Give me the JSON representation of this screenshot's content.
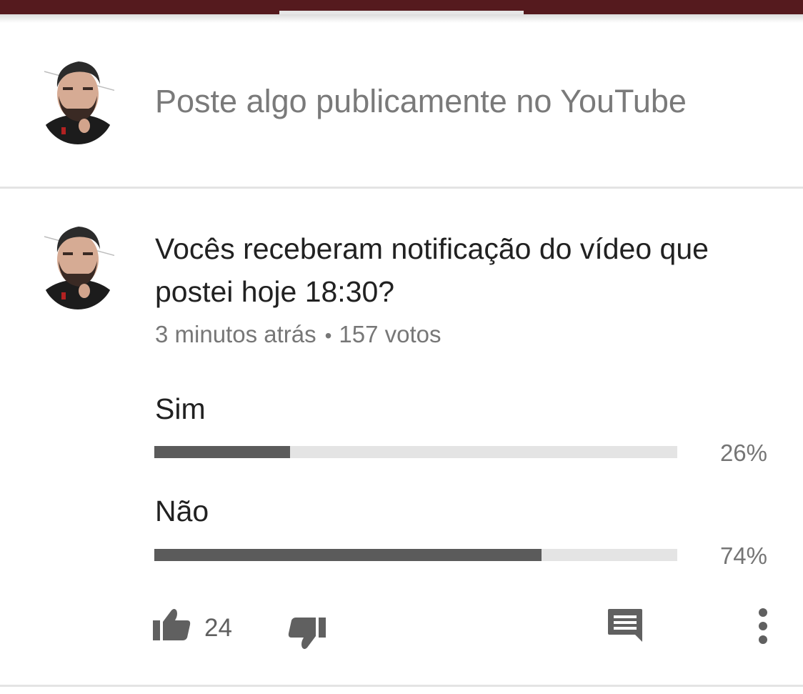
{
  "compose": {
    "placeholder": "Poste algo publicamente no YouTube"
  },
  "post": {
    "question": "Vocês receberam notificação do vídeo que postei hoje 18:30?",
    "time_ago": "3 minutos atrás",
    "separator": "•",
    "votes": "157 votos"
  },
  "poll": {
    "options": [
      {
        "label": "Sim",
        "percent_text": "26%",
        "fraction": 0.26
      },
      {
        "label": "Não",
        "percent_text": "74%",
        "fraction": 0.74
      }
    ]
  },
  "actions": {
    "like_count": "24",
    "icons": [
      "thumb-up-icon",
      "thumb-down-icon",
      "comment-icon",
      "more-vert-icon"
    ]
  },
  "colors": {
    "top_bar": "#551a1e",
    "bar_fill": "#5b5b5b",
    "bar_track": "#e4e4e4"
  }
}
